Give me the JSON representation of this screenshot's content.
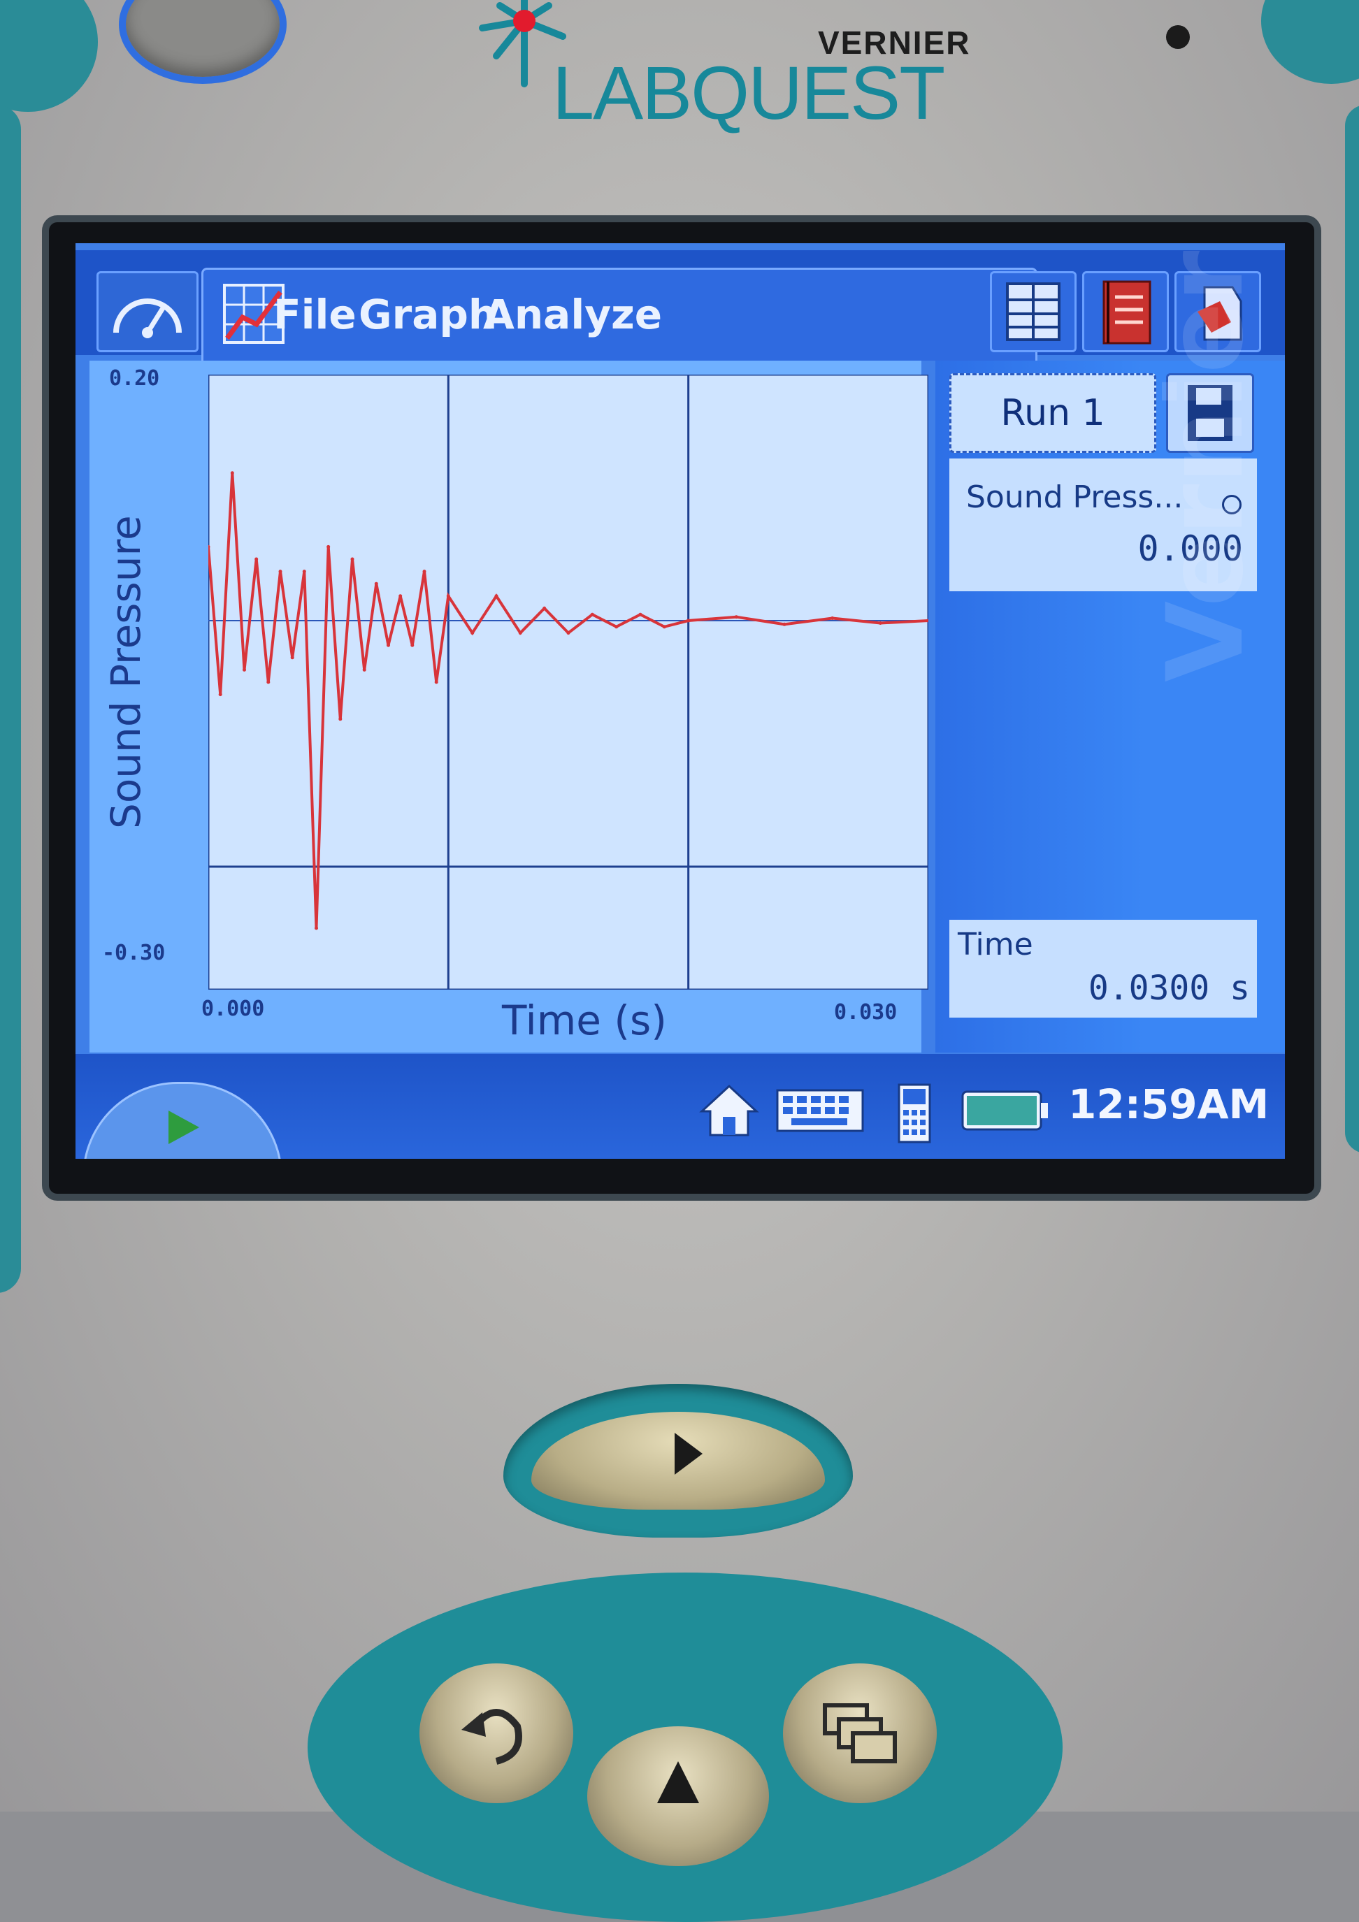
{
  "device": {
    "brand_small": "VERNIER",
    "brand_big": "LABQUEST",
    "accent_color": "#17889a"
  },
  "menu": {
    "items": [
      "File",
      "Graph",
      "Analyze"
    ],
    "tab_icons": [
      "meter-icon",
      "graph-icon",
      "table-icon",
      "notebook-icon",
      "rocket-icon"
    ]
  },
  "side_panel": {
    "run_label": "Run 1",
    "sensor_name": "Sound Press...",
    "sensor_value": "0.000",
    "time_label": "Time",
    "time_value": "0.0300 s",
    "watermark": "Vernier"
  },
  "statusbar": {
    "clock": "12:59AM",
    "icons": [
      "home-icon",
      "keyboard-icon",
      "device-icon",
      "battery-icon"
    ]
  },
  "chart_data": {
    "type": "line",
    "title": "",
    "xlabel": "Time (s)",
    "ylabel": "Sound Pressure",
    "xlim": [
      0.0,
      0.03
    ],
    "ylim": [
      -0.3,
      0.2
    ],
    "x_tick_labels": [
      "0.000",
      "0.030"
    ],
    "y_tick_labels": [
      "0.20",
      "-0.30"
    ],
    "grid": true,
    "series": [
      {
        "color": "#d8343a",
        "x": [
          0.0,
          0.0005,
          0.001,
          0.0015,
          0.002,
          0.0025,
          0.003,
          0.0035,
          0.004,
          0.0045,
          0.005,
          0.0055,
          0.006,
          0.0065,
          0.007,
          0.0075,
          0.008,
          0.0085,
          0.009,
          0.0095,
          0.01,
          0.011,
          0.012,
          0.013,
          0.014,
          0.015,
          0.016,
          0.017,
          0.018,
          0.019,
          0.02,
          0.022,
          0.024,
          0.026,
          0.028,
          0.03
        ],
        "y": [
          0.06,
          -0.06,
          0.12,
          -0.04,
          0.05,
          -0.05,
          0.04,
          -0.03,
          0.04,
          -0.25,
          0.06,
          -0.08,
          0.05,
          -0.04,
          0.03,
          -0.02,
          0.02,
          -0.02,
          0.04,
          -0.05,
          0.02,
          -0.01,
          0.02,
          -0.01,
          0.01,
          -0.01,
          0.005,
          -0.005,
          0.005,
          -0.005,
          0.0,
          0.003,
          -0.003,
          0.002,
          -0.002,
          0.0
        ]
      }
    ]
  }
}
